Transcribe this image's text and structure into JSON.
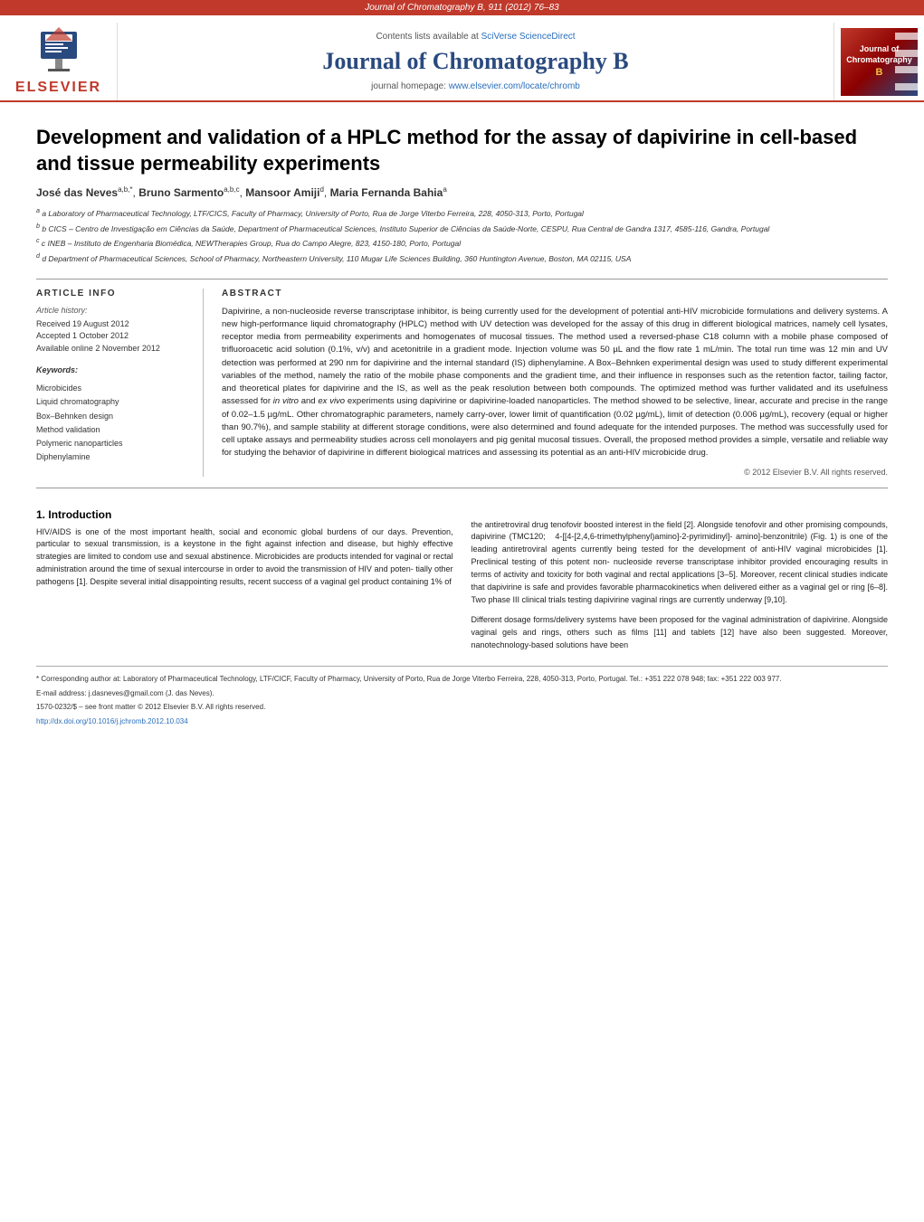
{
  "top_banner": {
    "text": "Journal of Chromatography B, 911 (2012) 76–83"
  },
  "header": {
    "sciverse_text": "Contents lists available at SciVerse ScienceDirect",
    "sciverse_link": "SciVerse ScienceDirect",
    "journal_title": "Journal of Chromatography B",
    "homepage_text": "journal homepage: www.elsevier.com/locate/chromb",
    "homepage_link": "www.elsevier.com/locate/chromb",
    "elsevier_text": "ELSEVIER"
  },
  "article": {
    "title": "Development and validation of a HPLC method for the assay of dapivirine in cell-based and tissue permeability experiments",
    "authors": "José das Neves a,b,*, Bruno Sarmento a,b,c, Mansoor Amiji d, Maria Fernanda Bahia a",
    "affiliations": [
      "a Laboratory of Pharmaceutical Technology, LTF/CICS, Faculty of Pharmacy, University of Porto, Rua de Jorge Viterbo Ferreira, 228, 4050-313, Porto, Portugal",
      "b CICS – Centro de Investigação em Ciências da Saúde, Department of Pharmaceutical Sciences, Instituto Superior de Ciências da Saúde-Norte, CESPU, Rua Central de Gandra 1317, 4585-116, Gandra, Portugal",
      "c INEB – Instituto de Engenharia Biomédica, NEWTherapies Group, Rua do Campo Alegre, 823, 4150-180, Porto, Portugal",
      "d Department of Pharmaceutical Sciences, School of Pharmacy, Northeastern University, 110 Mugar Life Sciences Building, 360 Huntington Avenue, Boston, MA 02115, USA"
    ]
  },
  "article_info": {
    "section_label": "ARTICLE INFO",
    "history_label": "Article history:",
    "received": "Received 19 August 2012",
    "accepted": "Accepted 1 October 2012",
    "available": "Available online 2 November 2012",
    "keywords_label": "Keywords:",
    "keywords": [
      "Microbicides",
      "Liquid chromatography",
      "Box–Behnken design",
      "Method validation",
      "Polymeric nanoparticles",
      "Diphenylamine"
    ]
  },
  "abstract": {
    "section_label": "ABSTRACT",
    "text": "Dapivirine, a non-nucleoside reverse transcriptase inhibitor, is being currently used for the development of potential anti-HIV microbicide formulations and delivery systems. A new high-performance liquid chromatography (HPLC) method with UV detection was developed for the assay of this drug in different biological matrices, namely cell lysates, receptor media from permeability experiments and homogenates of mucosal tissues. The method used a reversed-phase C18 column with a mobile phase composed of trifluoroacetic acid solution (0.1%, v/v) and acetonitrile in a gradient mode. Injection volume was 50 µL and the flow rate 1 mL/min. The total run time was 12 min and UV detection was performed at 290 nm for dapivirine and the internal standard (IS) diphenylamine. A Box–Behnken experimental design was used to study different experimental variables of the method, namely the ratio of the mobile phase components and the gradient time, and their influence in responses such as the retention factor, tailing factor, and theoretical plates for dapivirine and the IS, as well as the peak resolution between both compounds. The optimized method was further validated and its usefulness assessed for in vitro and ex vivo experiments using dapivirine or dapivirine-loaded nanoparticles. The method showed to be selective, linear, accurate and precise in the range of 0.02–1.5 µg/mL. Other chromatographic parameters, namely carry-over, lower limit of quantification (0.02 µg/mL), limit of detection (0.006 µg/mL), recovery (equal or higher than 90.7%), and sample stability at different storage conditions, were also determined and found adequate for the intended purposes. The method was successfully used for cell uptake assays and permeability studies across cell monolayers and pig genital mucosal tissues. Overall, the proposed method provides a simple, versatile and reliable way for studying the behavior of dapivirine in different biological matrices and assessing its potential as an anti-HIV microbicide drug.",
    "copyright": "© 2012 Elsevier B.V. All rights reserved."
  },
  "introduction": {
    "section_number": "1.",
    "section_title": "Introduction",
    "left_paragraph1": "HIV/AIDS is one of the most important health, social and economic global burdens of our days. Prevention, particular to sexual transmission, is a keystone in the fight against infection and disease, but highly effective strategies are limited to condom use and sexual abstinence. Microbicides are products intended for vaginal or rectal administration around the time of sexual intercourse in order to avoid the transmission of HIV and potentially other pathogens [1]. Despite several initial disappointing results, recent success of a vaginal gel product containing 1% of",
    "right_paragraph1": "the antiretroviral drug tenofovir boosted interest in the field [2]. Alongside tenofovir and other promising compounds, dapivirine (TMC120; 4-[[4-[2,4,6-trimethylphenyl)amino]-2-pyrimidinyl]-amino]-benzonitrile) (Fig. 1) is one of the leading antiretroviral agents currently being tested for the development of anti-HIV vaginal microbicides [1]. Preclinical testing of this potent non-nucleoside reverse transcriptase inhibitor provided encouraging results in terms of activity and toxicity for both vaginal and rectal applications [3–5]. Moreover, recent clinical studies indicate that dapivirine is safe and provides favorable pharmacokinetics when delivered either as a vaginal gel or ring [6–8]. Two phase III clinical trials testing dapivirine vaginal rings are currently underway [9,10].",
    "right_paragraph2": "Different dosage forms/delivery systems have been proposed for the vaginal administration of dapivirine. Alongside vaginal gels and rings, others such as films [11] and tablets [12] have also been suggested. Moreover, nanotechnology-based solutions have been"
  },
  "footnotes": {
    "corresponding_author": "* Corresponding author at: Laboratory of Pharmaceutical Technology, LTF/CICF, Faculty of Pharmacy, University of Porto, Rua de Jorge Viterbo Ferreira, 228, 4050-313, Porto, Portugal. Tel.: +351 222 078 948; fax: +351 222 003 977.",
    "email": "E-mail address: j.dasneves@gmail.com (J. das Neves).",
    "issn": "1570-0232/$ – see front matter © 2012 Elsevier B.V. All rights reserved.",
    "doi": "http://dx.doi.org/10.1016/j.jchromb.2012.10.034"
  }
}
